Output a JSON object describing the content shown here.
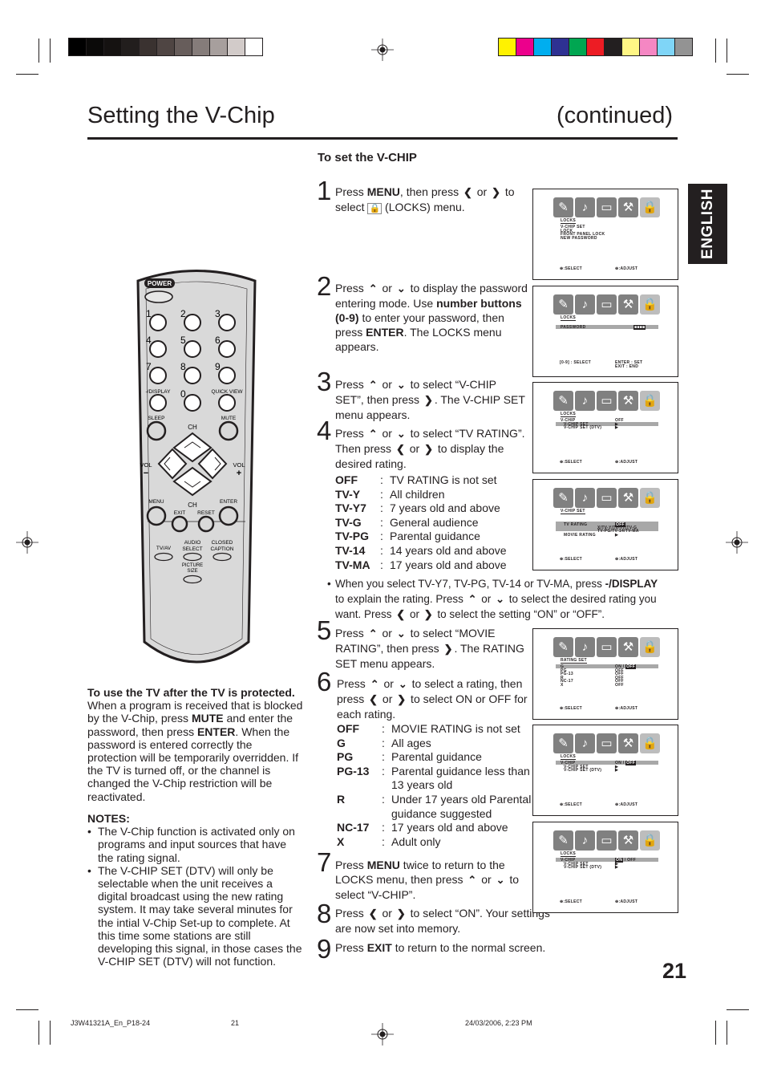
{
  "print_marks": {
    "gray_swatches": [
      "#000000",
      "#0b0a09",
      "#151211",
      "#221e1d",
      "#3a3230",
      "#4f4543",
      "#675d5b",
      "#857c7a",
      "#a79f9d",
      "#d2cbc9",
      "#ffffff"
    ],
    "color_swatches": [
      "#fff200",
      "#ec008c",
      "#00aeef",
      "#2e3192",
      "#00a651",
      "#ed1c24",
      "#231f20",
      "#fff685",
      "#f587c3",
      "#7fd5f7",
      "#939393"
    ]
  },
  "header": {
    "title": "Setting the V-Chip",
    "continued": "(continued)",
    "language_tab": "ENGLISH"
  },
  "section": {
    "heading": "To set the V-CHIP"
  },
  "steps": [
    {
      "num": "1",
      "parts": [
        "Press ",
        "MENU",
        ", then press ",
        "<",
        " or ",
        ">",
        " to select ",
        "lock",
        " (LOCKS) menu."
      ]
    },
    {
      "num": "2",
      "parts": [
        "Press ",
        "^",
        " or ",
        "v",
        " to display the password entering mode. Use ",
        "number buttons (0-9)",
        " to enter your password, then press ",
        "ENTER",
        ". The LOCKS menu appears."
      ]
    },
    {
      "num": "3",
      "parts": [
        "Press ",
        "^",
        " or ",
        "v",
        " to select “V-CHIP SET”, then press ",
        ">",
        ". The V-CHIP SET menu appears."
      ]
    },
    {
      "num": "4",
      "parts": [
        "Press ",
        "^",
        " or ",
        "v",
        " to select “TV RATING”. Then press ",
        "<",
        " or ",
        ">",
        " to display the desired rating."
      ]
    },
    {
      "num": "5",
      "parts": [
        "Press ",
        "^",
        " or ",
        "v",
        " to select “MOVIE RATING”, then press ",
        ">",
        ". The RATING SET menu appears."
      ]
    },
    {
      "num": "6",
      "parts": [
        "Press ",
        "^",
        " or ",
        "v",
        " to select a rating, then press ",
        "<",
        " or ",
        ">",
        " to select ON or OFF for each rating."
      ]
    },
    {
      "num": "7",
      "parts": [
        "Press ",
        "MENU",
        " twice to return to the LOCKS menu, then press ",
        "^",
        " or ",
        "v",
        " to select “V-CHIP”."
      ]
    },
    {
      "num": "8",
      "parts": [
        "Press ",
        "<",
        " or ",
        ">",
        " to select “ON”. Your settings are now set into memory."
      ]
    },
    {
      "num": "9",
      "parts": [
        "Press ",
        "EXIT",
        " to return to the normal screen."
      ]
    }
  ],
  "tv_ratings": [
    {
      "code": "OFF",
      "desc": "TV RATING is not set"
    },
    {
      "code": "TV-Y",
      "desc": "All children"
    },
    {
      "code": "TV-Y7",
      "desc": "7 years old and above"
    },
    {
      "code": "TV-G",
      "desc": "General audience"
    },
    {
      "code": "TV-PG",
      "desc": "Parental guidance"
    },
    {
      "code": "TV-14",
      "desc": "14 years old and above"
    },
    {
      "code": "TV-MA",
      "desc": "17 years old and above"
    }
  ],
  "tv_rating_note": {
    "line1_pre": "When you select TV-Y7, TV-PG, TV-14 or TV-MA, press ",
    "line1_bold": "-/DISPLAY",
    "line2": "to explain the rating. Press ^ or v to select the desired rating you want. Press < or > to select the setting “ON” or “OFF”."
  },
  "movie_ratings": [
    {
      "code": "OFF",
      "desc": "MOVIE RATING is not set"
    },
    {
      "code": "G",
      "desc": "All ages"
    },
    {
      "code": "PG",
      "desc": "Parental guidance"
    },
    {
      "code": "PG-13",
      "desc": "Parental guidance less than 13 years old"
    },
    {
      "code": "R",
      "desc": "Under 17 years old Parental guidance suggested"
    },
    {
      "code": "NC-17",
      "desc": "17 years old and above"
    },
    {
      "code": "X",
      "desc": "Adult only"
    }
  ],
  "osd_screens": [
    {
      "title": "LOCKS",
      "lines": [
        "V-CHIP SET",
        "LOCK",
        "FRONT PANEL LOCK",
        "NEW PASSWORD"
      ],
      "foot_left": "⊕:SELECT",
      "foot_right": "⊕:ADJUST"
    },
    {
      "title": "LOCKS",
      "lines": [
        "PASSWORD"
      ],
      "value": "■■■■",
      "foot_left": "[0-9] : SELECT",
      "foot_right": "ENTER : SET",
      "foot_right2": "EXIT : END"
    },
    {
      "title": "LOCKS",
      "lines": [
        "V-CHIP",
        "V-CHIP SET",
        "V-CHIP SET (DTV)"
      ],
      "values": [
        "OFF",
        "▶",
        "▶"
      ],
      "foot_left": "⊕:SELECT",
      "foot_right": "⊕:ADJUST"
    },
    {
      "title": "V-CHIP SET",
      "lines": [
        "TV RATING",
        "MOVIE RATING"
      ],
      "values": [
        "OFF",
        "▶"
      ],
      "sub_values": "X/TV-Y/TV-Y7/TV-G",
      "sub_values2": "TV-PG/TV-14/TV-MA",
      "foot_left": "⊕:SELECT",
      "foot_right": "⊕:ADJUST"
    },
    {
      "title": "RATING SET",
      "lines": [
        "G",
        "PG",
        "PG-13",
        "R",
        "NC-17",
        "X"
      ],
      "values": [
        "ON / OFF",
        "OFF",
        "OFF",
        "OFF",
        "OFF",
        "OFF"
      ],
      "foot_left": "⊕:SELECT",
      "foot_right": "⊕:ADJUST"
    },
    {
      "title": "LOCKS",
      "lines": [
        "V-CHIP",
        "V-CHIP SET",
        "V-CHIP SET (DTV)"
      ],
      "values": [
        "ON / OFF",
        "▶",
        "▶"
      ],
      "foot_left": "⊕:SELECT",
      "foot_right": "⊕:ADJUST"
    },
    {
      "title": "LOCKS",
      "lines": [
        "V-CHIP",
        "V-CHIP SET",
        "V-CHIP SET (DTV)"
      ],
      "values": [
        "ON / OFF",
        "▶",
        "▶"
      ],
      "foot_left": "⊕:SELECT",
      "foot_right": "⊕:ADJUST"
    }
  ],
  "remote": {
    "power": "POWER",
    "digits": [
      "1",
      "2",
      "3",
      "4",
      "5",
      "6",
      "7",
      "8",
      "9",
      "0"
    ],
    "display": "-/DISPLAY",
    "quick_view": "QUICK VIEW",
    "sleep": "SLEEP",
    "mute": "MUTE",
    "ch": "CH",
    "vol": "VOL",
    "vol_minus": "−",
    "vol_plus": "+",
    "menu": "MENU",
    "enter": "ENTER",
    "exit": "EXIT",
    "reset": "RESET",
    "tv_av": "TV/AV",
    "audio_select": "AUDIO SELECT",
    "closed_caption": "CLOSED CAPTION",
    "picture_size": "PICTURE SIZE"
  },
  "protected_note": {
    "heading": "To use the TV after the TV is protected.",
    "p1": "When a program is received that is blocked by the V-Chip, press ",
    "mute": "MUTE",
    "p2": " and enter the password, then press ",
    "enter": "ENTER",
    "p3": ". When the password is entered correctly the protection will be temporarily overridden. If the TV is turned off, or the channel is changed the V-Chip restriction will be reactivated."
  },
  "notes": {
    "heading": "NOTES:",
    "items": [
      "The V-Chip function is activated only on programs and input sources that have the rating signal.",
      "The V-CHIP SET (DTV) will only be selectable when the unit receives a digital broadcast using the new  rating system. It may take several minutes for the intial V-Chip Set-up to complete. At this time some stations are still developing this signal, in those cases the V-CHIP SET (DTV) will not function."
    ]
  },
  "page_number": "21",
  "footer": {
    "file": "J3W41321A_En_P18-24",
    "page": "21",
    "timestamp": "24/03/2006, 2:23 PM"
  }
}
